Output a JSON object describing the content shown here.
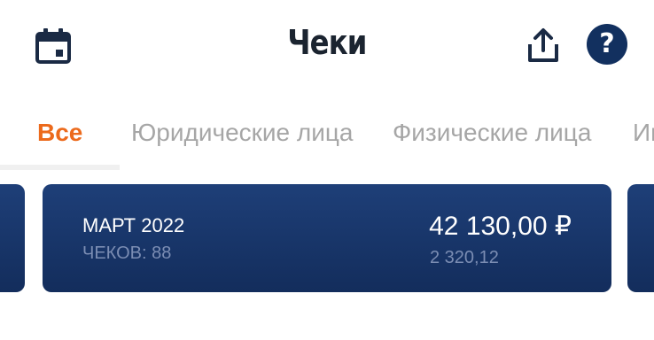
{
  "header": {
    "title": "Чеки",
    "icons": {
      "calendar": "calendar-icon",
      "share": "share-icon",
      "help": "help-icon"
    },
    "help_glyph": "?"
  },
  "tabs": [
    {
      "label": "Все",
      "active": true
    },
    {
      "label": "Юридические лица",
      "active": false
    },
    {
      "label": "Физические лица",
      "active": false
    },
    {
      "label": "Ин",
      "active": false
    }
  ],
  "card": {
    "period": "МАРТ 2022",
    "count_label": "ЧЕКОВ: 88",
    "amount": "42 130,00 ₽",
    "subamount": "2 320,12"
  },
  "colors": {
    "accent": "#ec6a1c",
    "card": "#1b3a70",
    "title": "#1b2430",
    "icon": "#1a2a44",
    "help_bg": "#12305f"
  }
}
